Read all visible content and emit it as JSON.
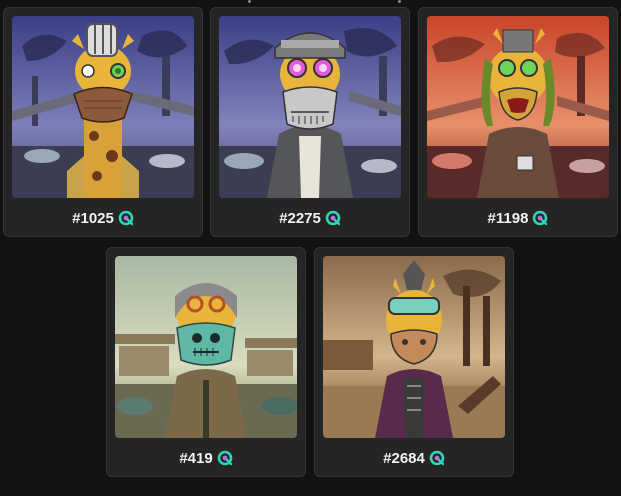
{
  "colors": {
    "page_bg": "#121212",
    "card_bg": "#252525",
    "card_border": "#353535",
    "text": "#f2f2f2",
    "badge_accent": "#2fd6b3"
  },
  "cards": [
    {
      "token": "#1025",
      "badge_icon": "verified-q-icon",
      "scene": "purple-industrial-giraffe-mask"
    },
    {
      "token": "#2275",
      "badge_icon": "verified-q-icon",
      "scene": "purple-industrial-giraffe-skull-hoodie"
    },
    {
      "token": "#1198",
      "badge_icon": "verified-q-icon",
      "scene": "red-industrial-giraffe-dreadlocks"
    },
    {
      "token": "#419",
      "badge_icon": "verified-q-icon",
      "scene": "green-desert-giraffe-skull-bandana"
    },
    {
      "token": "#2684",
      "badge_icon": "verified-q-icon",
      "scene": "sepia-desert-horse-goggles-jacket"
    }
  ]
}
